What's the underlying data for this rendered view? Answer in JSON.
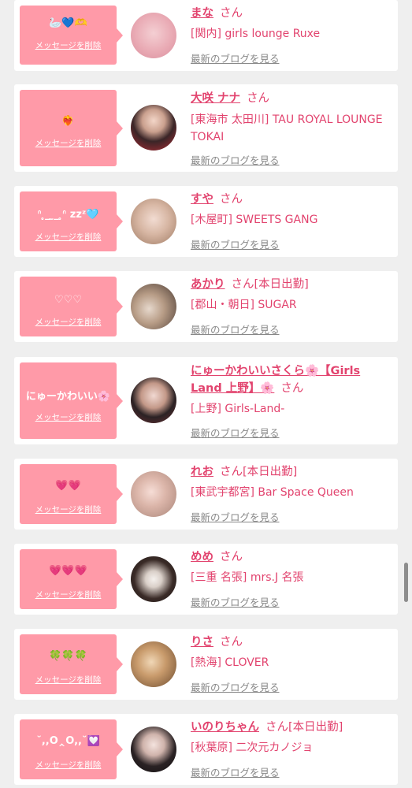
{
  "delete_label": "メッセージを削除",
  "san_label": "さん",
  "blog_label": "最新のブログを見る",
  "accent_color": "#e2436e",
  "bubble_color": "#ff9aa8",
  "items": [
    {
      "name": "まな",
      "status": "",
      "message": "🦢💙🫶",
      "shop": "[関内] girls lounge Ruxe",
      "avatar_icon": "blurred-portrait-icon"
    },
    {
      "name": "大咲 ナナ",
      "status": "",
      "message": "❤️‍🔥",
      "shop": "[東海市 太田川] TAU ROYAL LOUNGE TOKAI",
      "avatar_icon": "portrait-icon"
    },
    {
      "name": "すや",
      "status": "",
      "message": "ᐢ ̥_ ̫_ ̥ᐢ zzᶻ🩵",
      "shop": "[木屋町] SWEETS GANG",
      "avatar_icon": "portrait-icon"
    },
    {
      "name": "あかり",
      "status": "[本日出勤]",
      "message": "♡♡♡",
      "shop": "[郡山・朝日] SUGAR",
      "avatar_icon": "portrait-with-cat-icon"
    },
    {
      "name": "にゅーかわいいさくら🌸【Girls Land 上野】🌸",
      "status": "",
      "message": "にゅーかわいい🌸",
      "shop": "[上野] Girls-Land-",
      "avatar_icon": "portrait-icon"
    },
    {
      "name": "れお",
      "status": "[本日出勤]",
      "message": "💗💗",
      "shop": "[東武宇都宮] Bar Space Queen",
      "avatar_icon": "portrait-icon"
    },
    {
      "name": "めめ",
      "status": "",
      "message": "💗💗💗",
      "shop": "[三重 名張] mrs.J 名張",
      "avatar_icon": "portrait-icon"
    },
    {
      "name": "りさ",
      "status": "",
      "message": "🍀🍀🍀",
      "shop": "[熱海] CLOVER",
      "avatar_icon": "portrait-duo-icon"
    },
    {
      "name": "いのりちゃん",
      "status": "[本日出勤]",
      "message": "˘,,Ò‸Ó,,˘💟",
      "shop": "[秋葉原] 二次元カノジョ",
      "avatar_icon": "portrait-icon"
    }
  ]
}
